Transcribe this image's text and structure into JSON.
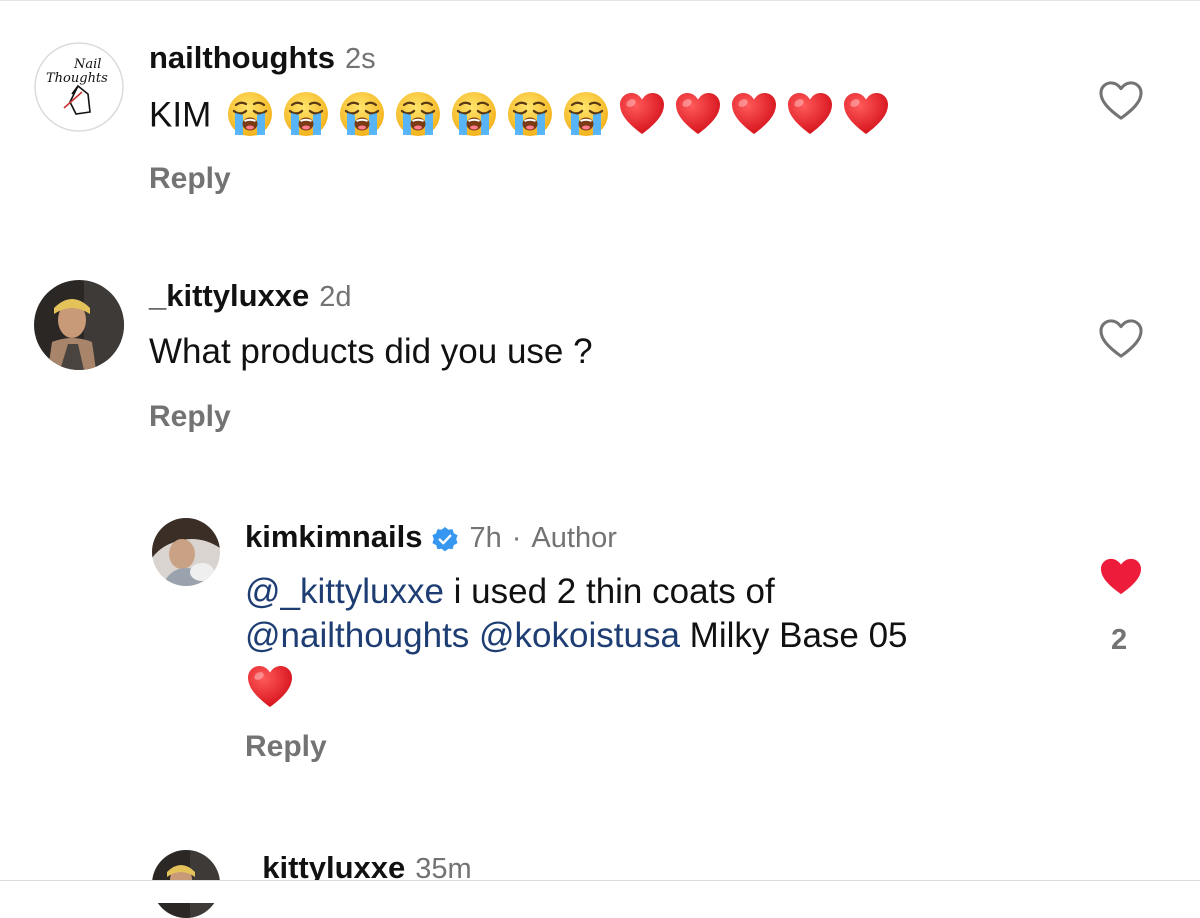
{
  "comments": [
    {
      "username": "nailthoughts",
      "time": "2s",
      "text": "KIM",
      "emojis": [
        "loudly-crying-face",
        "loudly-crying-face",
        "loudly-crying-face",
        "loudly-crying-face",
        "loudly-crying-face",
        "loudly-crying-face",
        "loudly-crying-face",
        "red-heart",
        "red-heart",
        "red-heart",
        "red-heart",
        "red-heart"
      ],
      "reply_label": "Reply",
      "liked": false,
      "avatar_logo_text": [
        "Nail",
        "Thoughts"
      ]
    },
    {
      "username": "_kittyluxxe",
      "time": "2d",
      "text": "What products did you use ?",
      "reply_label": "Reply",
      "liked": false
    },
    {
      "username": "kimkimnails",
      "verified": true,
      "time": "7h",
      "dot": "·",
      "author_label": "Author",
      "mention1": "@_kittyluxxe",
      "text1": " i used 2 thin coats of",
      "mention2": "@nailthoughts",
      "space": " ",
      "mention3": "@kokoistusa",
      "text2": " Milky Base 05",
      "trailing_emoji": "red-heart",
      "reply_label": "Reply",
      "liked": true,
      "like_count": "2"
    },
    {
      "username": "_kittyluxxe",
      "time": "35m"
    }
  ],
  "colors": {
    "text": "#111111",
    "secondary": "#737373",
    "mention": "#1d3d73",
    "like_active": "#ed1c3b",
    "verified": "#3797f0"
  },
  "icons": {
    "like": "heart-outline-icon",
    "liked": "heart-filled-icon",
    "verified": "verified-badge-icon"
  }
}
